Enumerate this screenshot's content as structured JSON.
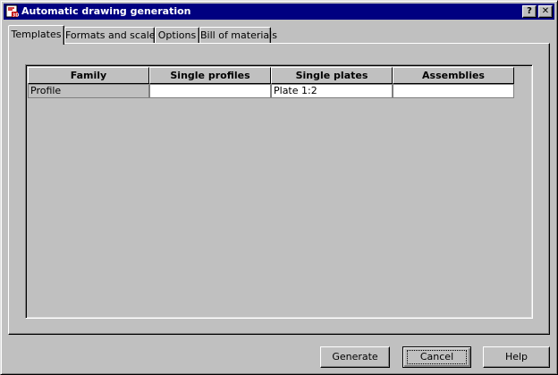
{
  "window": {
    "title": "Automatic drawing generation",
    "help_button": "?",
    "close_button": "✕"
  },
  "tabs": [
    {
      "label": "Templates",
      "active": true
    },
    {
      "label": "Formats and scales",
      "active": false
    },
    {
      "label": "Options",
      "active": false
    },
    {
      "label": "Bill of materials",
      "active": false
    }
  ],
  "table": {
    "columns": [
      "Family",
      "Single profiles",
      "Single plates",
      "Assemblies"
    ],
    "rows": [
      [
        "Profile",
        "",
        "Plate 1:2",
        ""
      ]
    ]
  },
  "buttons": {
    "generate": "Generate",
    "cancel": "Cancel",
    "help": "Help"
  }
}
